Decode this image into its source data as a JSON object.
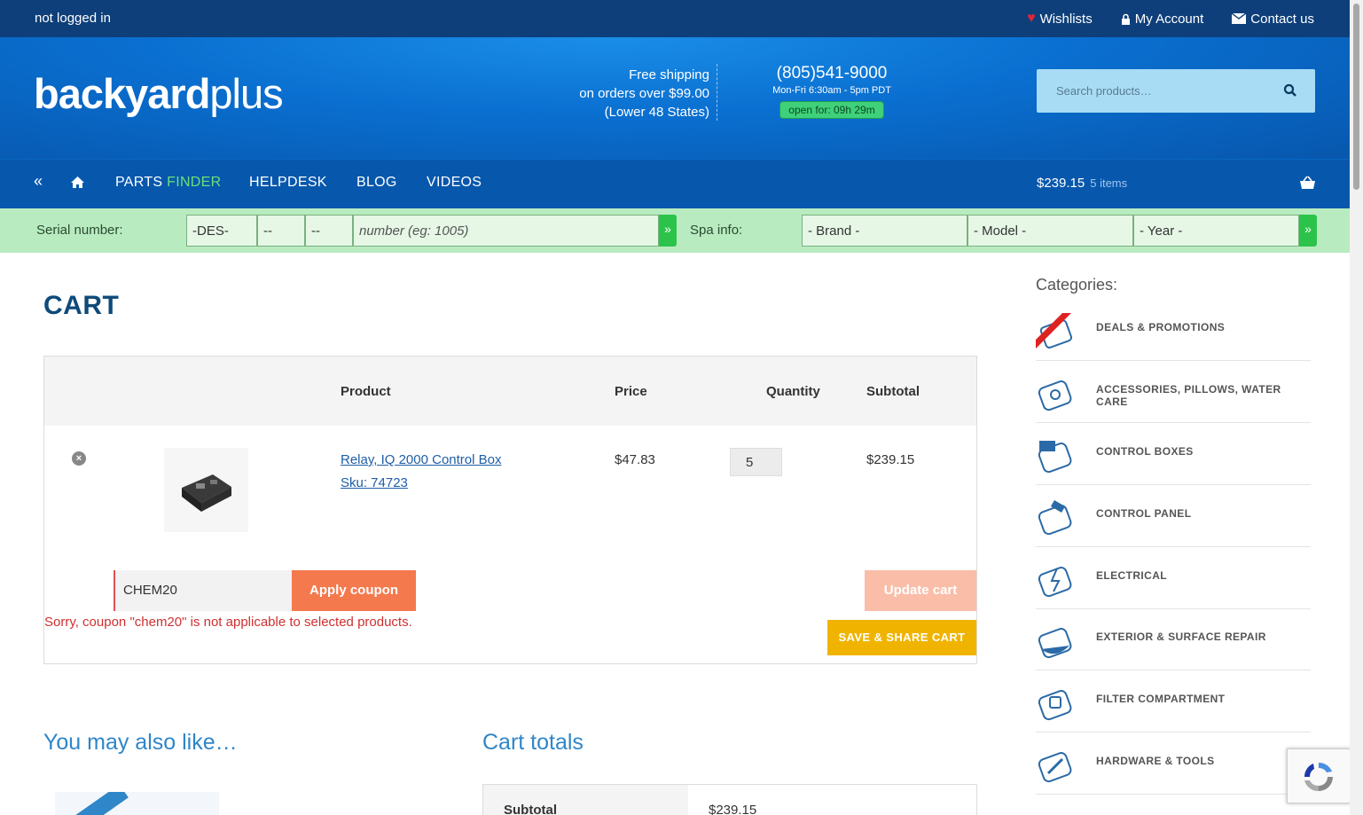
{
  "topbar": {
    "login_status": "not logged in",
    "wishlists": "Wishlists",
    "account": "My Account",
    "contact": "Contact us"
  },
  "header": {
    "logo_a": "backyard",
    "logo_b": "plus",
    "ship1": "Free shipping",
    "ship2": "on orders over $99.00",
    "ship3": "(Lower 48 States)",
    "phone": "(805)541-9000",
    "hours": "Mon-Fri 6:30am - 5pm PDT",
    "open": "open for: 09h 29m",
    "search_placeholder": "Search products…"
  },
  "nav": {
    "parts": "PARTS ",
    "finder": "FINDER",
    "helpdesk": "HELPDESK",
    "blog": "BLOG",
    "videos": "VIDEOS",
    "cart_amount": "$239.15",
    "cart_count": "5 items"
  },
  "serial": {
    "label": "Serial number:",
    "f1": "-DES-",
    "f2": "--",
    "f3": "--",
    "f4": "number (eg: 1005)",
    "spa_label": "Spa info:",
    "brand": "- Brand -",
    "model": "- Model -",
    "year": "- Year -"
  },
  "cart": {
    "title": "CART",
    "headers": {
      "product": "Product",
      "price": "Price",
      "quantity": "Quantity",
      "subtotal": "Subtotal"
    },
    "item": {
      "name": "Relay, IQ 2000 Control Box",
      "sku": "Sku: 74723",
      "price": "$47.83",
      "qty": "5",
      "subtotal": "$239.15"
    },
    "coupon_value": "CHEM20",
    "apply": "Apply coupon",
    "error": "Sorry, coupon \"chem20\" is not applicable to selected products.",
    "update": "Update cart",
    "share": "SAVE & SHARE CART"
  },
  "related": {
    "title": "You may also like…"
  },
  "totals": {
    "title": "Cart totals",
    "subtotal_label": "Subtotal",
    "subtotal_value": "$239.15"
  },
  "sidebar": {
    "heading": "Categories:",
    "items": [
      "DEALS & PROMOTIONS",
      "ACCESSORIES, PILLOWS, WATER CARE",
      "CONTROL BOXES",
      "CONTROL PANEL",
      "ELECTRICAL",
      "EXTERIOR & SURFACE REPAIR",
      "FILTER COMPARTMENT",
      "HARDWARE & TOOLS"
    ]
  },
  "colors": {
    "topbar": "#0e3f7a",
    "header": "#0a6fd0",
    "accent_green": "#6be07b",
    "coupon_orange": "#f4794d",
    "share_yellow": "#f0b400"
  }
}
